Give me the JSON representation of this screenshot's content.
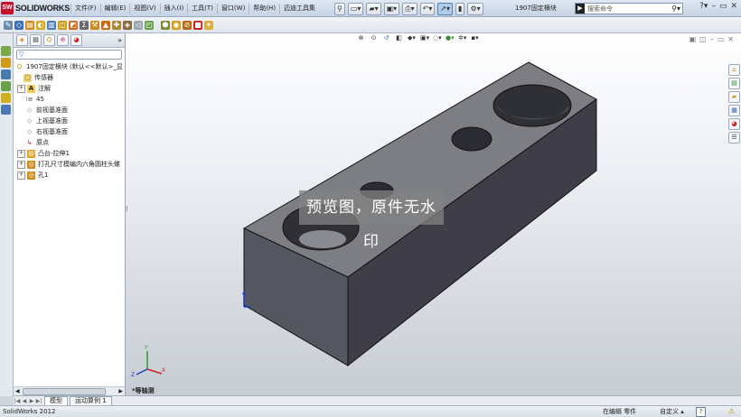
{
  "app": {
    "logo_text": "SOLIDWORKS",
    "logo_mark": "SW",
    "doc_title": "1907固定横块"
  },
  "menus": [
    "文件(F)",
    "编辑(E)",
    "视图(V)",
    "插入(I)",
    "工具(T)",
    "窗口(W)",
    "帮助(H)",
    "迈迪工具集"
  ],
  "search": {
    "placeholder": "搜索命令"
  },
  "tree": {
    "filter": "▽",
    "root": "1907固定横块 (默认<<默认>_显",
    "items": [
      "传感器",
      "注解",
      "45",
      "前视基准面",
      "上视基准面",
      "右视基准面",
      "原点",
      "凸台-拉伸1",
      "打孔尺寸模编内六角圆柱头螺",
      "孔1"
    ]
  },
  "viewport": {
    "view_name": "*等轴测",
    "watermark": "预览图，原件无水印"
  },
  "model_tabs": [
    "模型",
    "运动算例 1"
  ],
  "status": {
    "app_name": "SolidWorks 2012",
    "editing": "在编辑 零件",
    "custom": "自定义",
    "help": "?"
  },
  "colors": {
    "part_top": "#7d7f84",
    "part_front": "#56565e",
    "part_side": "#403f49",
    "accent_red": "#c8102e"
  },
  "icons": [
    "new-icon",
    "open-icon",
    "save-icon",
    "print-icon",
    "undo-icon",
    "select-icon",
    "rebuild-icon",
    "options-icon",
    "search-icon",
    "help-icon",
    "minimize-icon",
    "maximize-icon",
    "close-icon"
  ]
}
